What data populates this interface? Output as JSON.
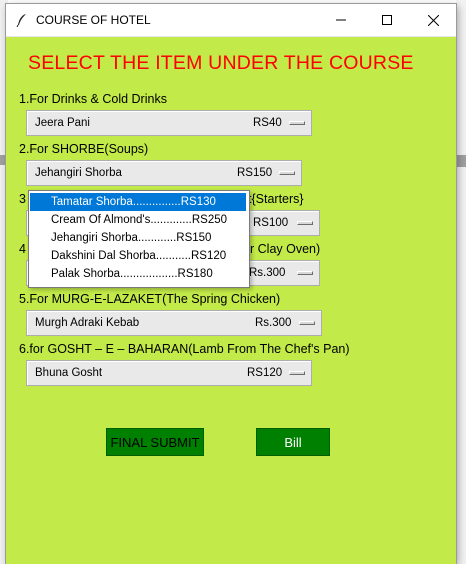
{
  "window": {
    "title": "COURSE OF HOTEL",
    "controls": {
      "minimize": "—",
      "maximize": "☐",
      "close": "✕"
    }
  },
  "heading": "SELECT THE ITEM UNDER THE COURSE",
  "sections": [
    {
      "label": "1.For Drinks & Cold Drinks",
      "selected_item": "Jeera Pani",
      "price": "RS40"
    },
    {
      "label": "2.For SHORBE(Soups)",
      "selected_item": "Jehangiri Shorba",
      "price": "RS150"
    },
    {
      "label_prefix": "3",
      "label_suffix": "t{Starters}",
      "price": "RS100"
    },
    {
      "label_prefix": "4",
      "label_suffix": "r Clay Oven)",
      "price": "Rs.300"
    },
    {
      "label": "5.For MURG-E-LAZAKET(The Spring Chicken)",
      "selected_item": "Murgh Adraki Kebab",
      "price": "Rs.300"
    },
    {
      "label": "6.for GOSHT – E – BAHARAN(Lamb From The Chef's Pan)",
      "selected_item": "Bhuna Gosht",
      "price": "RS120"
    }
  ],
  "dropdown": {
    "open_for": "2.For SHORBE(Soups)",
    "options": [
      {
        "label": "Tamatar Shorba...............RS130",
        "selected": true
      },
      {
        "label": "Cream Of Almond's.............RS250",
        "selected": false
      },
      {
        "label": "Jehangiri Shorba............RS150",
        "selected": false
      },
      {
        "label": "Dakshini Dal Shorba...........RS120",
        "selected": false
      },
      {
        "label": "Palak Shorba..................RS180",
        "selected": false
      }
    ]
  },
  "buttons": {
    "final_submit": "FINAL SUBMIT",
    "bill": "Bill"
  },
  "colors": {
    "window_bg": "#c2ea48",
    "heading": "#ff0000",
    "button_bg": "#008000",
    "dropdown_highlight": "#0078d7"
  }
}
